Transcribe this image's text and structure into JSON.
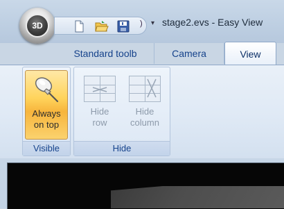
{
  "window": {
    "app_orb_label": "3D",
    "title": "stage2.evs - Easy View"
  },
  "quick_access": {
    "more_glyph": "▾"
  },
  "tabs": [
    {
      "label": "Standard toolb"
    },
    {
      "label": "Camera"
    },
    {
      "label": "View",
      "active": true
    }
  ],
  "ribbon": {
    "groups": [
      {
        "label": "Visible",
        "buttons": [
          {
            "label_line1": "Always",
            "label_line2": "on top",
            "state": "active",
            "icon": "pushpin-icon"
          }
        ]
      },
      {
        "label": "Hide",
        "buttons": [
          {
            "label_line1": "Hide",
            "label_line2": "row",
            "state": "disabled",
            "icon": "hide-row-icon"
          },
          {
            "label_line1": "Hide",
            "label_line2": "column",
            "state": "disabled",
            "icon": "hide-column-icon"
          }
        ]
      }
    ]
  },
  "colors": {
    "tab_text": "#15428b",
    "active_button": "#ffd45c",
    "disabled_text": "#8d9aaa",
    "viewport_bg": "#060606"
  }
}
